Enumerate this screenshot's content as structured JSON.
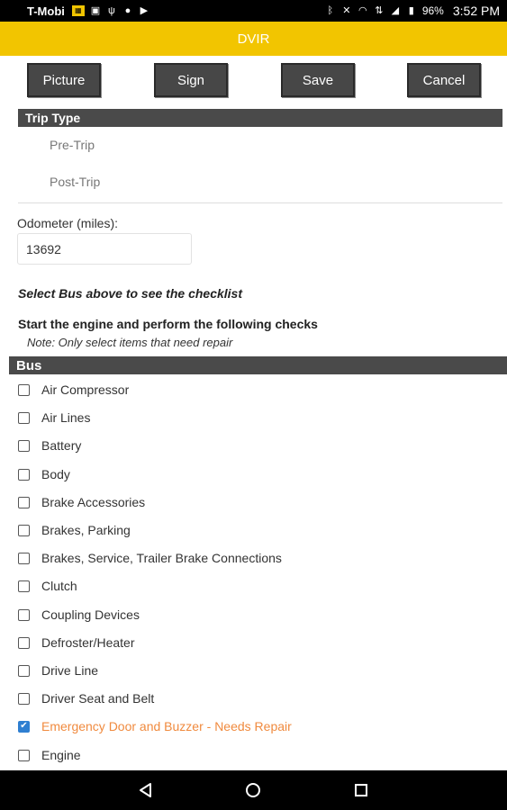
{
  "status_bar": {
    "carrier": "T-Mobi",
    "battery": "96%",
    "time": "3:52 PM"
  },
  "app": {
    "title": "DVIR"
  },
  "toolbar": {
    "picture_label": "Picture",
    "sign_label": "Sign",
    "save_label": "Save",
    "cancel_label": "Cancel"
  },
  "trip_type": {
    "header": "Trip Type",
    "options": [
      "Pre-Trip",
      "Post-Trip"
    ]
  },
  "odometer": {
    "label": "Odometer (miles):",
    "value": "13692"
  },
  "select_note": "Select Bus above to see the checklist",
  "instructions": "Start the engine and perform the following checks",
  "note": "Note: Only select items that need repair",
  "bus_section": {
    "header": "Bus",
    "items": [
      {
        "label": "Air Compressor",
        "checked": false
      },
      {
        "label": "Air Lines",
        "checked": false
      },
      {
        "label": "Battery",
        "checked": false
      },
      {
        "label": "Body",
        "checked": false
      },
      {
        "label": "Brake Accessories",
        "checked": false
      },
      {
        "label": "Brakes, Parking",
        "checked": false
      },
      {
        "label": "Brakes, Service, Trailer Brake Connections",
        "checked": false
      },
      {
        "label": "Clutch",
        "checked": false
      },
      {
        "label": "Coupling Devices",
        "checked": false
      },
      {
        "label": "Defroster/Heater",
        "checked": false
      },
      {
        "label": "Drive Line",
        "checked": false
      },
      {
        "label": "Driver Seat and Belt",
        "checked": false
      },
      {
        "label": "Emergency Door and Buzzer - Needs Repair",
        "checked": true
      },
      {
        "label": "Engine",
        "checked": false
      }
    ]
  },
  "colors": {
    "app_bar": "#f2c500",
    "header_bg": "#4a4a4a",
    "button_bg": "#474747",
    "repair_text": "#f08a3e",
    "checkbox_checked": "#2f7fd1"
  },
  "icons": {
    "nav": [
      "back-icon",
      "home-icon",
      "recents-icon"
    ]
  }
}
